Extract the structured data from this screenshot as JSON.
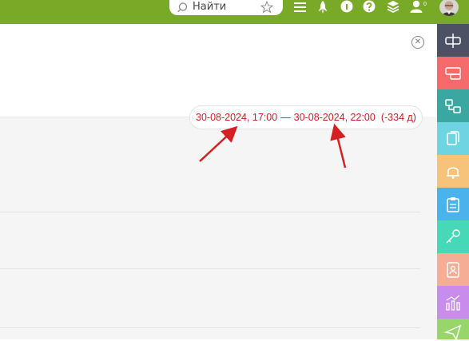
{
  "search": {
    "placeholder": "Найти"
  },
  "topbar": {
    "icons": [
      "search-icon",
      "star-icon",
      "menu-icon",
      "rocket-icon",
      "info-icon",
      "help-icon",
      "layers-icon",
      "user-icon",
      "avatar"
    ],
    "user_badge": "0"
  },
  "date_range": {
    "start": "30-08-2024, 17:00",
    "separator": "—",
    "end": "30-08-2024, 22:00",
    "days": "(-334 д)"
  },
  "rail": [
    {
      "name": "resize-icon",
      "color": "#4c5264"
    },
    {
      "name": "window-icon",
      "color": "#f56b6b"
    },
    {
      "name": "flow-icon",
      "color": "#3aa8a0"
    },
    {
      "name": "copy-icon",
      "color": "#6fd4e2"
    },
    {
      "name": "bell-icon",
      "color": "#f7c27a"
    },
    {
      "name": "clipboard-icon",
      "color": "#4ab3ec"
    },
    {
      "name": "key-icon",
      "color": "#47d9b7"
    },
    {
      "name": "contact-icon",
      "color": "#f5ad95"
    },
    {
      "name": "analytics-icon",
      "color": "#c78cec"
    },
    {
      "name": "send-icon",
      "color": "#98d66a"
    }
  ]
}
